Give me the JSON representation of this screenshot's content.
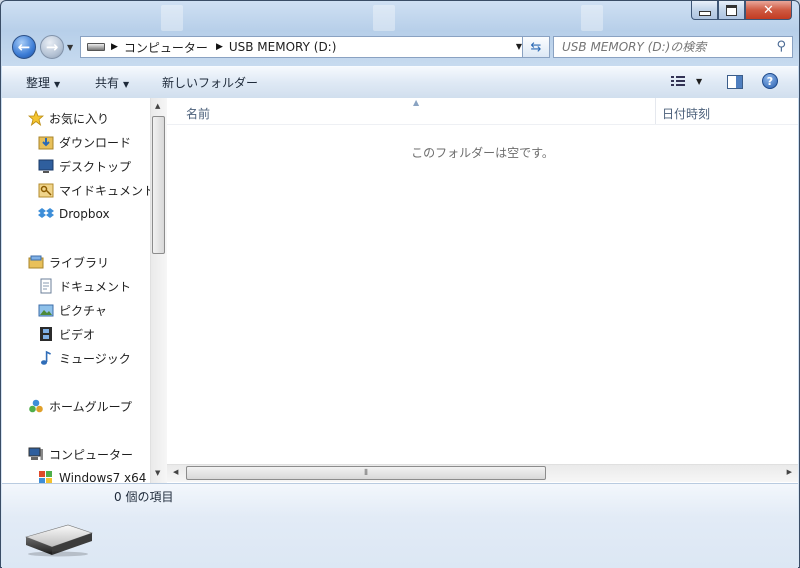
{
  "address": {
    "crumbs": [
      "コンピューター",
      "USB MEMORY (D:)"
    ]
  },
  "search": {
    "placeholder": "USB MEMORY (D:)の検索"
  },
  "toolbar": {
    "organize": "整理",
    "share": "共有",
    "new_folder": "新しいフォルダー"
  },
  "nav": {
    "favorites": "お気に入り",
    "downloads": "ダウンロード",
    "desktop": "デスクトップ",
    "my_documents": "マイドキュメント",
    "dropbox": "Dropbox",
    "libraries": "ライブラリ",
    "documents": "ドキュメント",
    "pictures": "ピクチャ",
    "videos": "ビデオ",
    "music": "ミュージック",
    "homegroup": "ホームグループ",
    "computer": "コンピューター",
    "windows7": "Windows7 x64"
  },
  "columns": {
    "name": "名前",
    "date": "日付時刻"
  },
  "content": {
    "empty_message": "このフォルダーは空です。"
  },
  "details": {
    "item_count": "0 個の項目"
  },
  "icons": {
    "back": "back-arrow-icon",
    "forward": "forward-arrow-icon",
    "refresh": "refresh-icon",
    "search": "magnifier-icon",
    "help": "question-mark-icon",
    "drive": "usb-drive-icon"
  },
  "colors": {
    "accent": "#3d7dd6",
    "content_bg": "#ffffff",
    "frame": "#c9dcf0"
  }
}
